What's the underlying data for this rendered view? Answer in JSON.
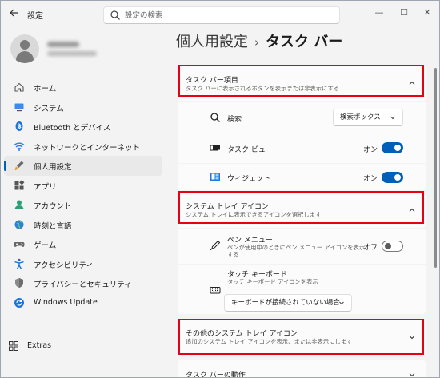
{
  "window": {
    "app_title": "設定",
    "search_placeholder": "設定の検索",
    "controls": {
      "minimize": "—",
      "maximize": "☐",
      "close": "✕"
    }
  },
  "sidebar": {
    "items": [
      {
        "label": "ホーム",
        "icon": "home-icon",
        "active": false
      },
      {
        "label": "システム",
        "icon": "system-icon",
        "active": false
      },
      {
        "label": "Bluetooth とデバイス",
        "icon": "bluetooth-icon",
        "active": false
      },
      {
        "label": "ネットワークとインターネット",
        "icon": "wifi-icon",
        "active": false
      },
      {
        "label": "個人用設定",
        "icon": "brush-icon",
        "active": true
      },
      {
        "label": "アプリ",
        "icon": "apps-icon",
        "active": false
      },
      {
        "label": "アカウント",
        "icon": "account-icon",
        "active": false
      },
      {
        "label": "時刻と言語",
        "icon": "globe-icon",
        "active": false
      },
      {
        "label": "ゲーム",
        "icon": "gamepad-icon",
        "active": false
      },
      {
        "label": "アクセシビリティ",
        "icon": "accessibility-icon",
        "active": false
      },
      {
        "label": "プライバシーとセキュリティ",
        "icon": "shield-icon",
        "active": false
      },
      {
        "label": "Windows Update",
        "icon": "update-icon",
        "active": false
      },
      {
        "label": "Extras",
        "icon": "extras-icon",
        "active": false
      }
    ]
  },
  "breadcrumb": {
    "parent": "個人用設定",
    "separator": "›",
    "current": "タスク バー"
  },
  "sections": {
    "taskbar_items": {
      "title": "タスク バー項目",
      "desc": "タスク バーに表示されるボタンを表示または非表示にする",
      "rows": {
        "search": {
          "label": "検索",
          "dropdown_value": "検索ボックス"
        },
        "task_view": {
          "label": "タスク ビュー",
          "state": "オン"
        },
        "widgets": {
          "label": "ウィジェット",
          "state": "オン"
        }
      }
    },
    "system_tray": {
      "title": "システム トレイ アイコン",
      "desc": "システム トレイに表示できるアイコンを選択します",
      "rows": {
        "pen_menu": {
          "label": "ペン メニュー",
          "desc_line1": "ペンが使用中のときにペン メニュー アイコンを表示",
          "desc_line2": "する",
          "state": "オフ"
        },
        "touch_keyboard": {
          "label": "タッチ キーボード",
          "desc": "タッチ キーボード アイコンを表示",
          "dropdown_value": "キーボードが接続されていない場合"
        }
      }
    },
    "other_tray": {
      "title": "その他のシステム トレイ アイコン",
      "desc": "追加のシステム トレイ アイコンを表示、または非表示にします"
    },
    "taskbar_behavior": {
      "title": "タスク バーの動作"
    }
  },
  "colors": {
    "accent": "#005fb8",
    "highlight_box": "#e60012",
    "background": "#f3f3f3",
    "card": "#fbfbfb"
  }
}
